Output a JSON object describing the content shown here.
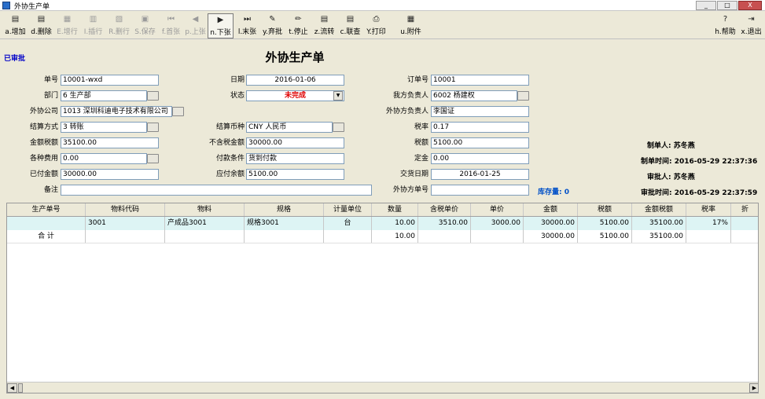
{
  "window": {
    "title": "外协生产单",
    "min": "_",
    "max": "□",
    "close": "X"
  },
  "toolbar": [
    {
      "label": "a.增加",
      "icon": "add-doc-icon",
      "glyph": "▤",
      "disabled": false
    },
    {
      "label": "d.删除",
      "icon": "delete-doc-icon",
      "glyph": "▤",
      "disabled": false
    },
    {
      "label": "E.增行",
      "icon": "add-row-icon",
      "glyph": "▦",
      "disabled": true
    },
    {
      "label": "I.插行",
      "icon": "insert-row-icon",
      "glyph": "▥",
      "disabled": true
    },
    {
      "label": "R.删行",
      "icon": "delete-row-icon",
      "glyph": "▧",
      "disabled": true
    },
    {
      "label": "S.保存",
      "icon": "save-icon",
      "glyph": "▣",
      "disabled": true
    },
    {
      "label": "f.首张",
      "icon": "first-record-icon",
      "glyph": "⏮",
      "disabled": true
    },
    {
      "label": "p.上张",
      "icon": "prev-record-icon",
      "glyph": "◀",
      "disabled": true
    },
    {
      "label": "n.下张",
      "icon": "next-record-icon",
      "glyph": "▶",
      "disabled": false
    },
    {
      "label": "l.末张",
      "icon": "last-record-icon",
      "glyph": "⏭",
      "disabled": false
    },
    {
      "label": "y.弃批",
      "icon": "unapprove-icon",
      "glyph": "✎",
      "disabled": false
    },
    {
      "label": "t.停止",
      "icon": "stop-icon",
      "glyph": "✏",
      "disabled": false
    },
    {
      "label": "z.流转",
      "icon": "flow-icon",
      "glyph": "▤",
      "disabled": false
    },
    {
      "label": "c.联查",
      "icon": "query-icon",
      "glyph": "▤",
      "disabled": false
    },
    {
      "label": "Y.打印",
      "icon": "print-icon",
      "glyph": "⎙",
      "disabled": false
    },
    {
      "label": "u.附件",
      "icon": "attachment-icon",
      "glyph": "▦",
      "disabled": false
    },
    {
      "label": "h.帮助",
      "icon": "help-icon",
      "glyph": "?",
      "disabled": false
    },
    {
      "label": "x.退出",
      "icon": "exit-icon",
      "glyph": "⇥",
      "disabled": false
    }
  ],
  "doc": {
    "status": "已审批",
    "title": "外协生产单"
  },
  "form": {
    "order_no_label": "单号",
    "order_no": "10001-wxd",
    "date_label": "日期",
    "date": "2016-01-06",
    "sales_order_label": "订单号",
    "sales_order": "10001",
    "dept_label": "部门",
    "dept": "6 生产部",
    "state_label": "状态",
    "state": "未完成",
    "our_person_label": "我方负责人",
    "our_person": "6002 杨建权",
    "vendor_label": "外协公司",
    "vendor": "1013 深圳科迪电子技术有限公司",
    "vendor_person_label": "外协方负责人",
    "vendor_person": "李国证",
    "settle_method_label": "结算方式",
    "settle_method": "3 转账",
    "currency_label": "结算币种",
    "currency": "CNY 人民币",
    "tax_rate_label": "税率",
    "tax_rate": "0.17",
    "amount_tax_label": "金额税额",
    "amount_tax": "35100.00",
    "amount_notax_label": "不含税金额",
    "amount_notax": "30000.00",
    "tax_label": "税额",
    "tax": "5100.00",
    "fees_label": "各种费用",
    "fees": "0.00",
    "pay_terms_label": "付款条件",
    "pay_terms": "货到付款",
    "deposit_label": "定金",
    "deposit": "0.00",
    "paid_label": "已付金额",
    "paid": "30000.00",
    "balance_label": "应付余额",
    "balance": "5100.00",
    "delivery_label": "交货日期",
    "delivery": "2016-01-25",
    "remark_label": "备注",
    "remark": "",
    "vendor_no_label": "外协方单号",
    "vendor_no": "",
    "stock_label": "库存量: 0"
  },
  "info": {
    "maker": "制单人: 苏冬燕",
    "make_time": "制单时间: 2016-05-29 22:37:36",
    "approver": "审批人: 苏冬燕",
    "approve_time": "审批时间: 2016-05-29 22:37:59"
  },
  "grid": {
    "columns": [
      "生产单号",
      "物料代码",
      "物料",
      "规格",
      "计量单位",
      "数量",
      "含税单价",
      "单价",
      "金额",
      "税额",
      "金额税额",
      "税率",
      "折"
    ],
    "row": [
      "",
      "3001",
      "产成品3001",
      "规格3001",
      "台",
      "10.00",
      "3510.00",
      "3000.00",
      "30000.00",
      "5100.00",
      "35100.00",
      "17%",
      ""
    ],
    "total": [
      "合 计",
      "",
      "",
      "",
      "",
      "10.00",
      "",
      "",
      "30000.00",
      "5100.00",
      "35100.00",
      "",
      ""
    ]
  }
}
